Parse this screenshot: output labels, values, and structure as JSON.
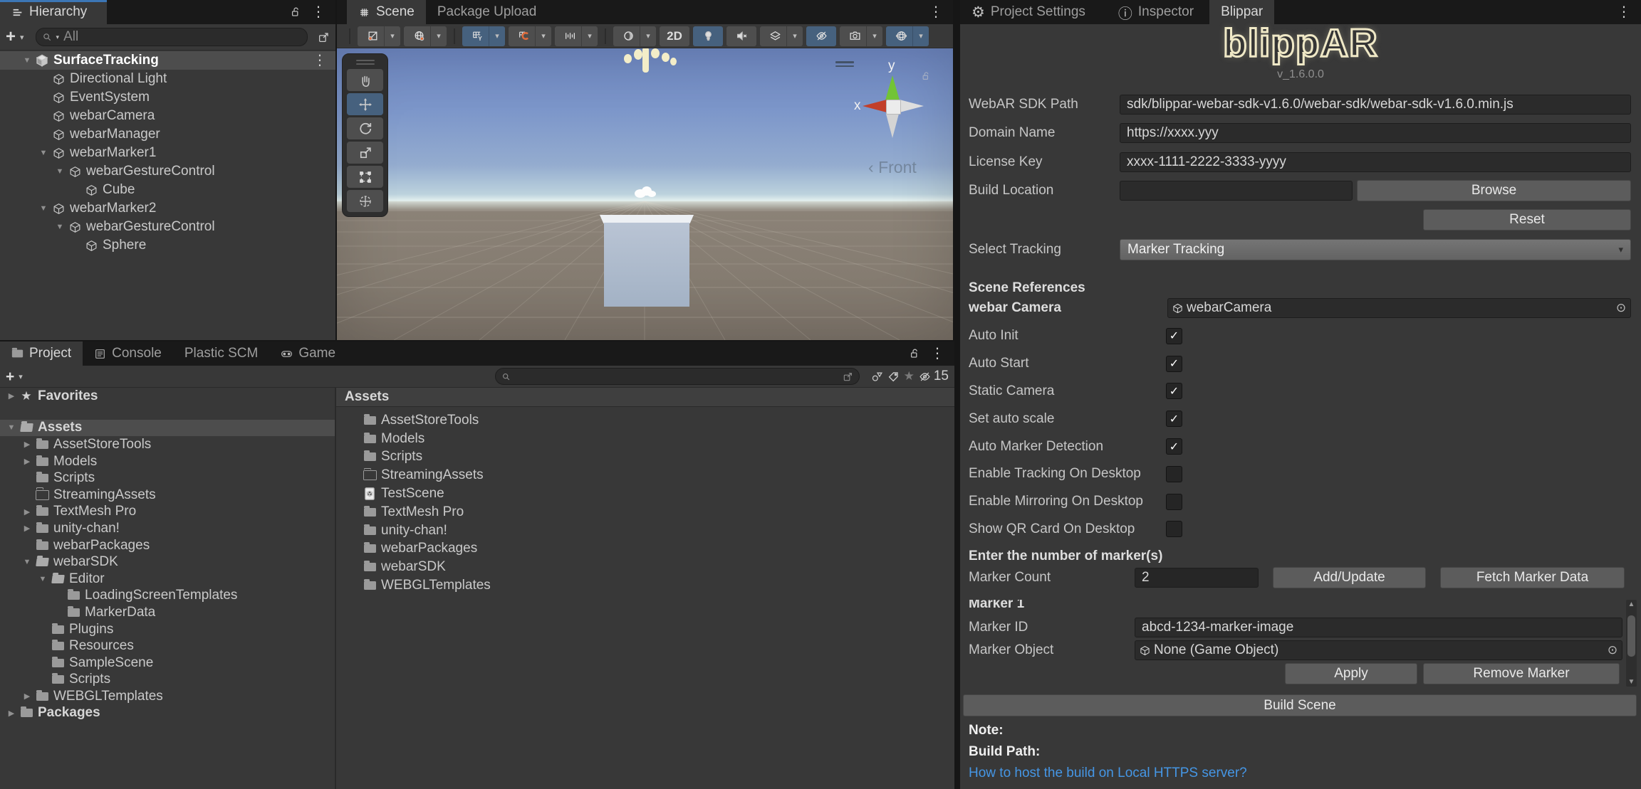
{
  "colors": {
    "focus_blue": "#3C76B5",
    "selection_grey": "#4D4D4D",
    "accent_orange": "#E06C3C",
    "toolbar_active_blue": "#46617E",
    "link_blue": "#4596E5",
    "logo_cream": "#EFE8C6"
  },
  "hierarchy": {
    "tab_label": "Hierarchy",
    "search_placeholder": "All",
    "tree": [
      {
        "label": "SurfaceTracking",
        "depth": 0,
        "icon": "scene",
        "arrow": "expanded",
        "selected": true
      },
      {
        "label": "Directional Light",
        "depth": 1,
        "icon": "object"
      },
      {
        "label": "EventSystem",
        "depth": 1,
        "icon": "object"
      },
      {
        "label": "webarCamera",
        "depth": 1,
        "icon": "object"
      },
      {
        "label": "webarManager",
        "depth": 1,
        "icon": "object"
      },
      {
        "label": "webarMarker1",
        "depth": 1,
        "icon": "object",
        "arrow": "expanded"
      },
      {
        "label": "webarGestureControl",
        "depth": 2,
        "icon": "object",
        "arrow": "expanded"
      },
      {
        "label": "Cube",
        "depth": 3,
        "icon": "object"
      },
      {
        "label": "webarMarker2",
        "depth": 1,
        "icon": "object",
        "arrow": "expanded"
      },
      {
        "label": "webarGestureControl",
        "depth": 2,
        "icon": "object",
        "arrow": "expanded"
      },
      {
        "label": "Sphere",
        "depth": 3,
        "icon": "object"
      }
    ]
  },
  "scene": {
    "tab_scene": "Scene",
    "tab_package": "Package Upload",
    "toolbar_2d": "2D",
    "gizmo": {
      "x": "x",
      "y": "y",
      "front_arrow": "‹",
      "front": "Front"
    }
  },
  "project": {
    "tab_project": "Project",
    "tab_console": "Console",
    "tab_plastic": "Plastic SCM",
    "tab_game": "Game",
    "hidden_count": "15",
    "assets_header": "Assets",
    "tree": [
      {
        "label": "Favorites",
        "depth": 0,
        "icon": "star",
        "arrow": "collapsed",
        "gap": true
      },
      {
        "label": "Assets",
        "depth": 0,
        "icon": "folder-open",
        "arrow": "expanded",
        "selected": true
      },
      {
        "label": "AssetStoreTools",
        "depth": 1,
        "icon": "folder",
        "arrow": "collapsed"
      },
      {
        "label": "Models",
        "depth": 1,
        "icon": "folder",
        "arrow": "collapsed"
      },
      {
        "label": "Scripts",
        "depth": 1,
        "icon": "folder"
      },
      {
        "label": "StreamingAssets",
        "depth": 1,
        "icon": "folder-empty"
      },
      {
        "label": "TextMesh Pro",
        "depth": 1,
        "icon": "folder",
        "arrow": "collapsed"
      },
      {
        "label": "unity-chan!",
        "depth": 1,
        "icon": "folder",
        "arrow": "collapsed"
      },
      {
        "label": "webarPackages",
        "depth": 1,
        "icon": "folder"
      },
      {
        "label": "webarSDK",
        "depth": 1,
        "icon": "folder-open",
        "arrow": "expanded"
      },
      {
        "label": "Editor",
        "depth": 2,
        "icon": "folder-open",
        "arrow": "expanded"
      },
      {
        "label": "LoadingScreenTemplates",
        "depth": 3,
        "icon": "folder"
      },
      {
        "label": "MarkerData",
        "depth": 3,
        "icon": "folder"
      },
      {
        "label": "Plugins",
        "depth": 2,
        "icon": "folder"
      },
      {
        "label": "Resources",
        "depth": 2,
        "icon": "folder"
      },
      {
        "label": "SampleScene",
        "depth": 2,
        "icon": "folder"
      },
      {
        "label": "Scripts",
        "depth": 2,
        "icon": "folder"
      },
      {
        "label": "WEBGLTemplates",
        "depth": 1,
        "icon": "folder",
        "arrow": "collapsed"
      },
      {
        "label": "Packages",
        "depth": 0,
        "icon": "folder",
        "arrow": "collapsed"
      }
    ],
    "assets_list": [
      {
        "label": "AssetStoreTools",
        "icon": "folder"
      },
      {
        "label": "Models",
        "icon": "folder"
      },
      {
        "label": "Scripts",
        "icon": "folder"
      },
      {
        "label": "StreamingAssets",
        "icon": "folder-empty"
      },
      {
        "label": "TestScene",
        "icon": "scene-file"
      },
      {
        "label": "TextMesh Pro",
        "icon": "folder"
      },
      {
        "label": "unity-chan!",
        "icon": "folder"
      },
      {
        "label": "webarPackages",
        "icon": "folder"
      },
      {
        "label": "webarSDK",
        "icon": "folder"
      },
      {
        "label": "WEBGLTemplates",
        "icon": "folder"
      }
    ]
  },
  "inspector": {
    "tab_project_settings": "Project Settings",
    "tab_inspector": "Inspector",
    "tab_blippar": "Blippar",
    "logo": "blippAR",
    "version": "v_1.6.0.0",
    "webar_sdk_path_label": "WebAR SDK Path",
    "webar_sdk_path_value": "sdk/blippar-webar-sdk-v1.6.0/webar-sdk/webar-sdk-v1.6.0.min.js",
    "domain_label": "Domain Name",
    "domain_value": "https://xxxx.yyy",
    "license_label": "License Key",
    "license_value": "xxxx-1111-2222-3333-yyyy",
    "build_location_label": "Build Location",
    "build_location_value": "",
    "browse": "Browse",
    "reset": "Reset",
    "select_tracking_label": "Select Tracking",
    "select_tracking_value": "Marker Tracking",
    "scene_references": "Scene References",
    "webar_camera_label": "webar Camera",
    "webar_camera_value": "webarCamera",
    "checkboxes": [
      {
        "label": "Auto Init",
        "checked": true
      },
      {
        "label": "Auto Start",
        "checked": true
      },
      {
        "label": "Static Camera",
        "checked": true
      },
      {
        "label": "Set auto scale",
        "checked": true
      },
      {
        "label": "Auto Marker Detection",
        "checked": true
      },
      {
        "label": "Enable Tracking On Desktop",
        "checked": false
      },
      {
        "label": "Enable Mirroring On Desktop",
        "checked": false
      },
      {
        "label": "Show QR Card On Desktop",
        "checked": false
      }
    ],
    "marker_count_header": "Enter the number of marker(s)",
    "marker_count_label": "Marker Count",
    "marker_count_value": "2",
    "add_update": "Add/Update",
    "fetch_marker_data": "Fetch Marker Data",
    "marker_header": "Marker 1",
    "marker_id_label": "Marker ID",
    "marker_id_value": "abcd-1234-marker-image",
    "marker_object_label": "Marker Object",
    "marker_object_value": "None (Game Object)",
    "apply": "Apply",
    "remove_marker": "Remove Marker",
    "build_scene": "Build Scene",
    "note_label": "Note:",
    "build_path_label": "Build Path:",
    "link": "How to host the build on Local HTTPS server?"
  },
  "icons": {
    "check": "✓",
    "kebab": "⋮",
    "picker": "⊙",
    "chevron_down": "▾",
    "expanded": "▼",
    "collapsed": "▶",
    "gear": "⚙",
    "info": "ⓘ",
    "star": "★",
    "plus": "+"
  }
}
